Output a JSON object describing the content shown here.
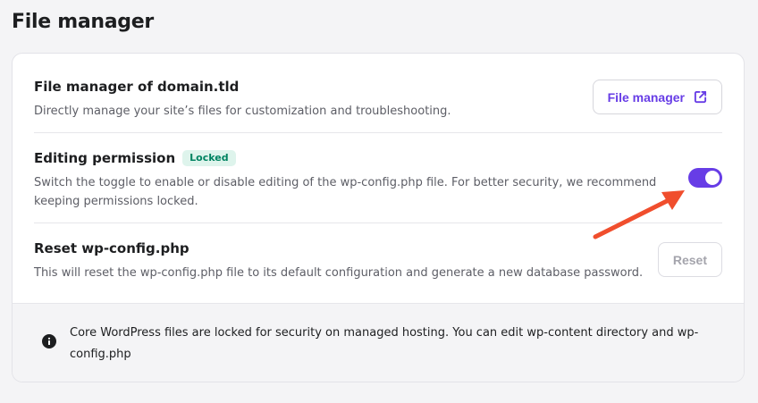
{
  "page": {
    "title": "File manager"
  },
  "file_manager_row": {
    "title": "File manager of domain.tld",
    "description": "Directly manage your site’s files for customization and troubleshooting.",
    "button_label": "File manager",
    "button_icon": "external-link-icon"
  },
  "editing_row": {
    "title": "Editing permission",
    "badge": "Locked",
    "description": "Switch the toggle to enable or disable editing of the wp-config.php file. For better security, we recommend keeping permissions locked.",
    "toggle_on": true
  },
  "reset_row": {
    "title": "Reset wp-config.php",
    "description": "This will reset the wp-config.php file to its default configuration and generate a new database password.",
    "button_label": "Reset"
  },
  "info": {
    "icon": "info-icon",
    "text": "Core WordPress files are locked for security on managed hosting. You can edit wp-content directory and wp-config.php"
  },
  "colors": {
    "accent": "#673de6",
    "badge_text": "#008361",
    "badge_bg": "#def4ec",
    "annotation_arrow": "#f04e2d"
  }
}
